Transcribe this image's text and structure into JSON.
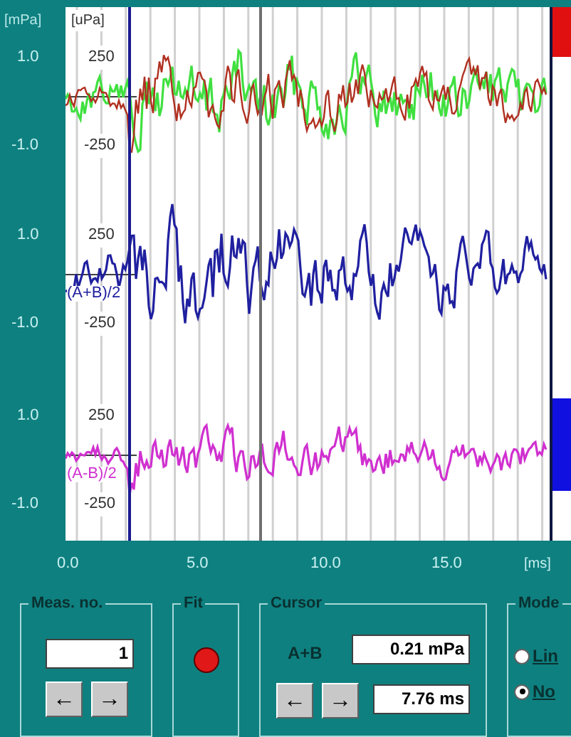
{
  "plot": {
    "left_unit": "[mPa]",
    "right_unit": "[uPa]",
    "x_unit": "[ms]",
    "x_ticks": [
      "0.0",
      "5.0",
      "10.0",
      "15.0"
    ],
    "traces": [
      {
        "left_ticks": [
          "1.0",
          "-1.0"
        ],
        "right_ticks": [
          "250",
          "-250"
        ],
        "waveforms": [
          {
            "color": "#40e040"
          },
          {
            "color": "#b03020"
          }
        ]
      },
      {
        "label": "(A+B)/2",
        "left_ticks": [
          "1.0",
          "-1.0"
        ],
        "right_ticks": [
          "250",
          "-250"
        ],
        "waveforms": [
          {
            "color": "#2020a0"
          }
        ]
      },
      {
        "label": "(A-B)/2",
        "left_ticks": [
          "1.0",
          "-1.0"
        ],
        "right_ticks": [
          "250",
          "-250"
        ],
        "waveforms": [
          {
            "color": "#d030d0"
          }
        ]
      }
    ]
  },
  "meas": {
    "title": "Meas. no.",
    "value": "1",
    "buttons": [
      "←",
      "→"
    ]
  },
  "fit": {
    "title": "Fit",
    "on": true
  },
  "cursor": {
    "title": "Cursor",
    "label": "A+B",
    "value": "0.21 mPa",
    "time": "7.76 ms",
    "buttons": [
      "←",
      "→"
    ]
  },
  "mode": {
    "title": "Mode",
    "options": [
      {
        "label": "Lin",
        "selected": false
      },
      {
        "label": "No",
        "selected": true
      }
    ]
  }
}
